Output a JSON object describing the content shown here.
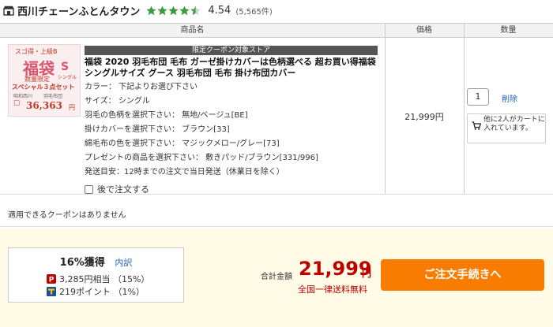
{
  "shop": {
    "name": "西川チェーンふとんタウン",
    "rating": "4.54",
    "review_count": "(5,565件)",
    "stars": 4.5
  },
  "table_headers": {
    "product": "商品名",
    "price": "価格",
    "quantity": "数量"
  },
  "item": {
    "campaign_label": "限定クーポン対象ストア",
    "title": "福袋 2020 羽毛布団 毛布 ガーゼ掛けカバーは色柄選べる 超お買い得福袋 シングルサイズ グース 羽毛布団 毛布 掛け布団カバー",
    "attributes": [
      "カラー： 下記よりお選び下さい",
      "サイズ： シングル",
      "羽毛の色柄を選択下さい： 無地/ベージュ[BE]",
      "掛けカバーを選択下さい： ブラウン[33]",
      "綿毛布の色を選択下さい： マジックメロー/グレー[73]",
      "プレゼントの商品を選択下さい： 敷きパッド/ブラウン[331/996]",
      "発送目安：12時までの注文で当日発送（休業日を除く）"
    ],
    "later_label": "後で注文する",
    "price": "21,999円",
    "quantity": "1",
    "delete_label": "削除",
    "cart_notice": "他に2人がカートに入れています。",
    "thumb": {
      "top_badge": "スゴ得・上級B",
      "main": "福袋",
      "size": "シングル",
      "limited": "数量限定",
      "set": "スペシャル３点セット",
      "brand": "昭和西川",
      "item": "羽毛布団",
      "price": "36,363",
      "yen": "円"
    }
  },
  "coupon": {
    "text": "適用できるクーポンはありません"
  },
  "points": {
    "headline": "16%獲得",
    "detail_link": "内訳",
    "lines": [
      "3,285円相当 （15%）",
      "219ポイント （1%）"
    ]
  },
  "total": {
    "label": "合計金額",
    "amount": "21,999",
    "yen": "円",
    "shipping": "全国一律送料無料"
  },
  "checkout": {
    "label": "ご注文手続きへ"
  },
  "colors": {
    "accent_red": "#bf0000",
    "checkout_orange": "#f77c00",
    "link_blue": "#1a5fb4",
    "star_green": "#3a9b3a",
    "summary_bg": "#fffbe6"
  }
}
